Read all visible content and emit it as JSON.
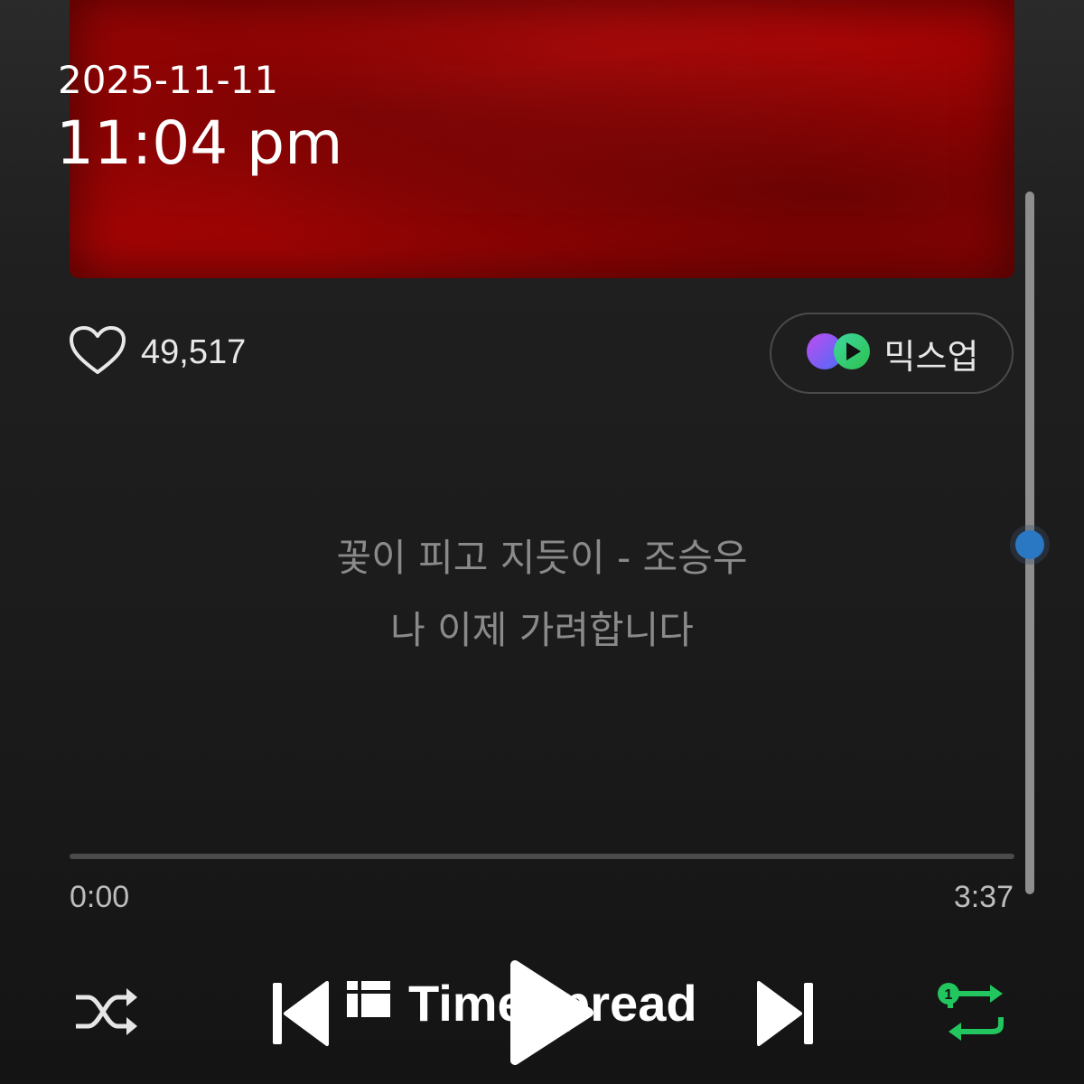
{
  "overlay": {
    "date": "2025-11-11",
    "time": "11:04 pm"
  },
  "likes": {
    "count": "49,517"
  },
  "mixup": {
    "label": "믹스업"
  },
  "lyrics": {
    "line1": "꽃이 피고 지듯이 - 조승우",
    "line2": "나 이제 가려합니다"
  },
  "playback": {
    "current": "0:00",
    "total": "3:37",
    "progress": 0
  },
  "controls": {
    "repeat_badge": "1"
  },
  "watermark": {
    "text": "TimeSpread"
  },
  "colors": {
    "accent_green": "#22c55e",
    "scroll_thumb": "#2a78c4",
    "album": "#a40404"
  },
  "icons": [
    "heart-icon",
    "mixup-icon",
    "shuffle-icon",
    "previous-icon",
    "play-icon",
    "next-icon",
    "repeat-one-icon"
  ]
}
